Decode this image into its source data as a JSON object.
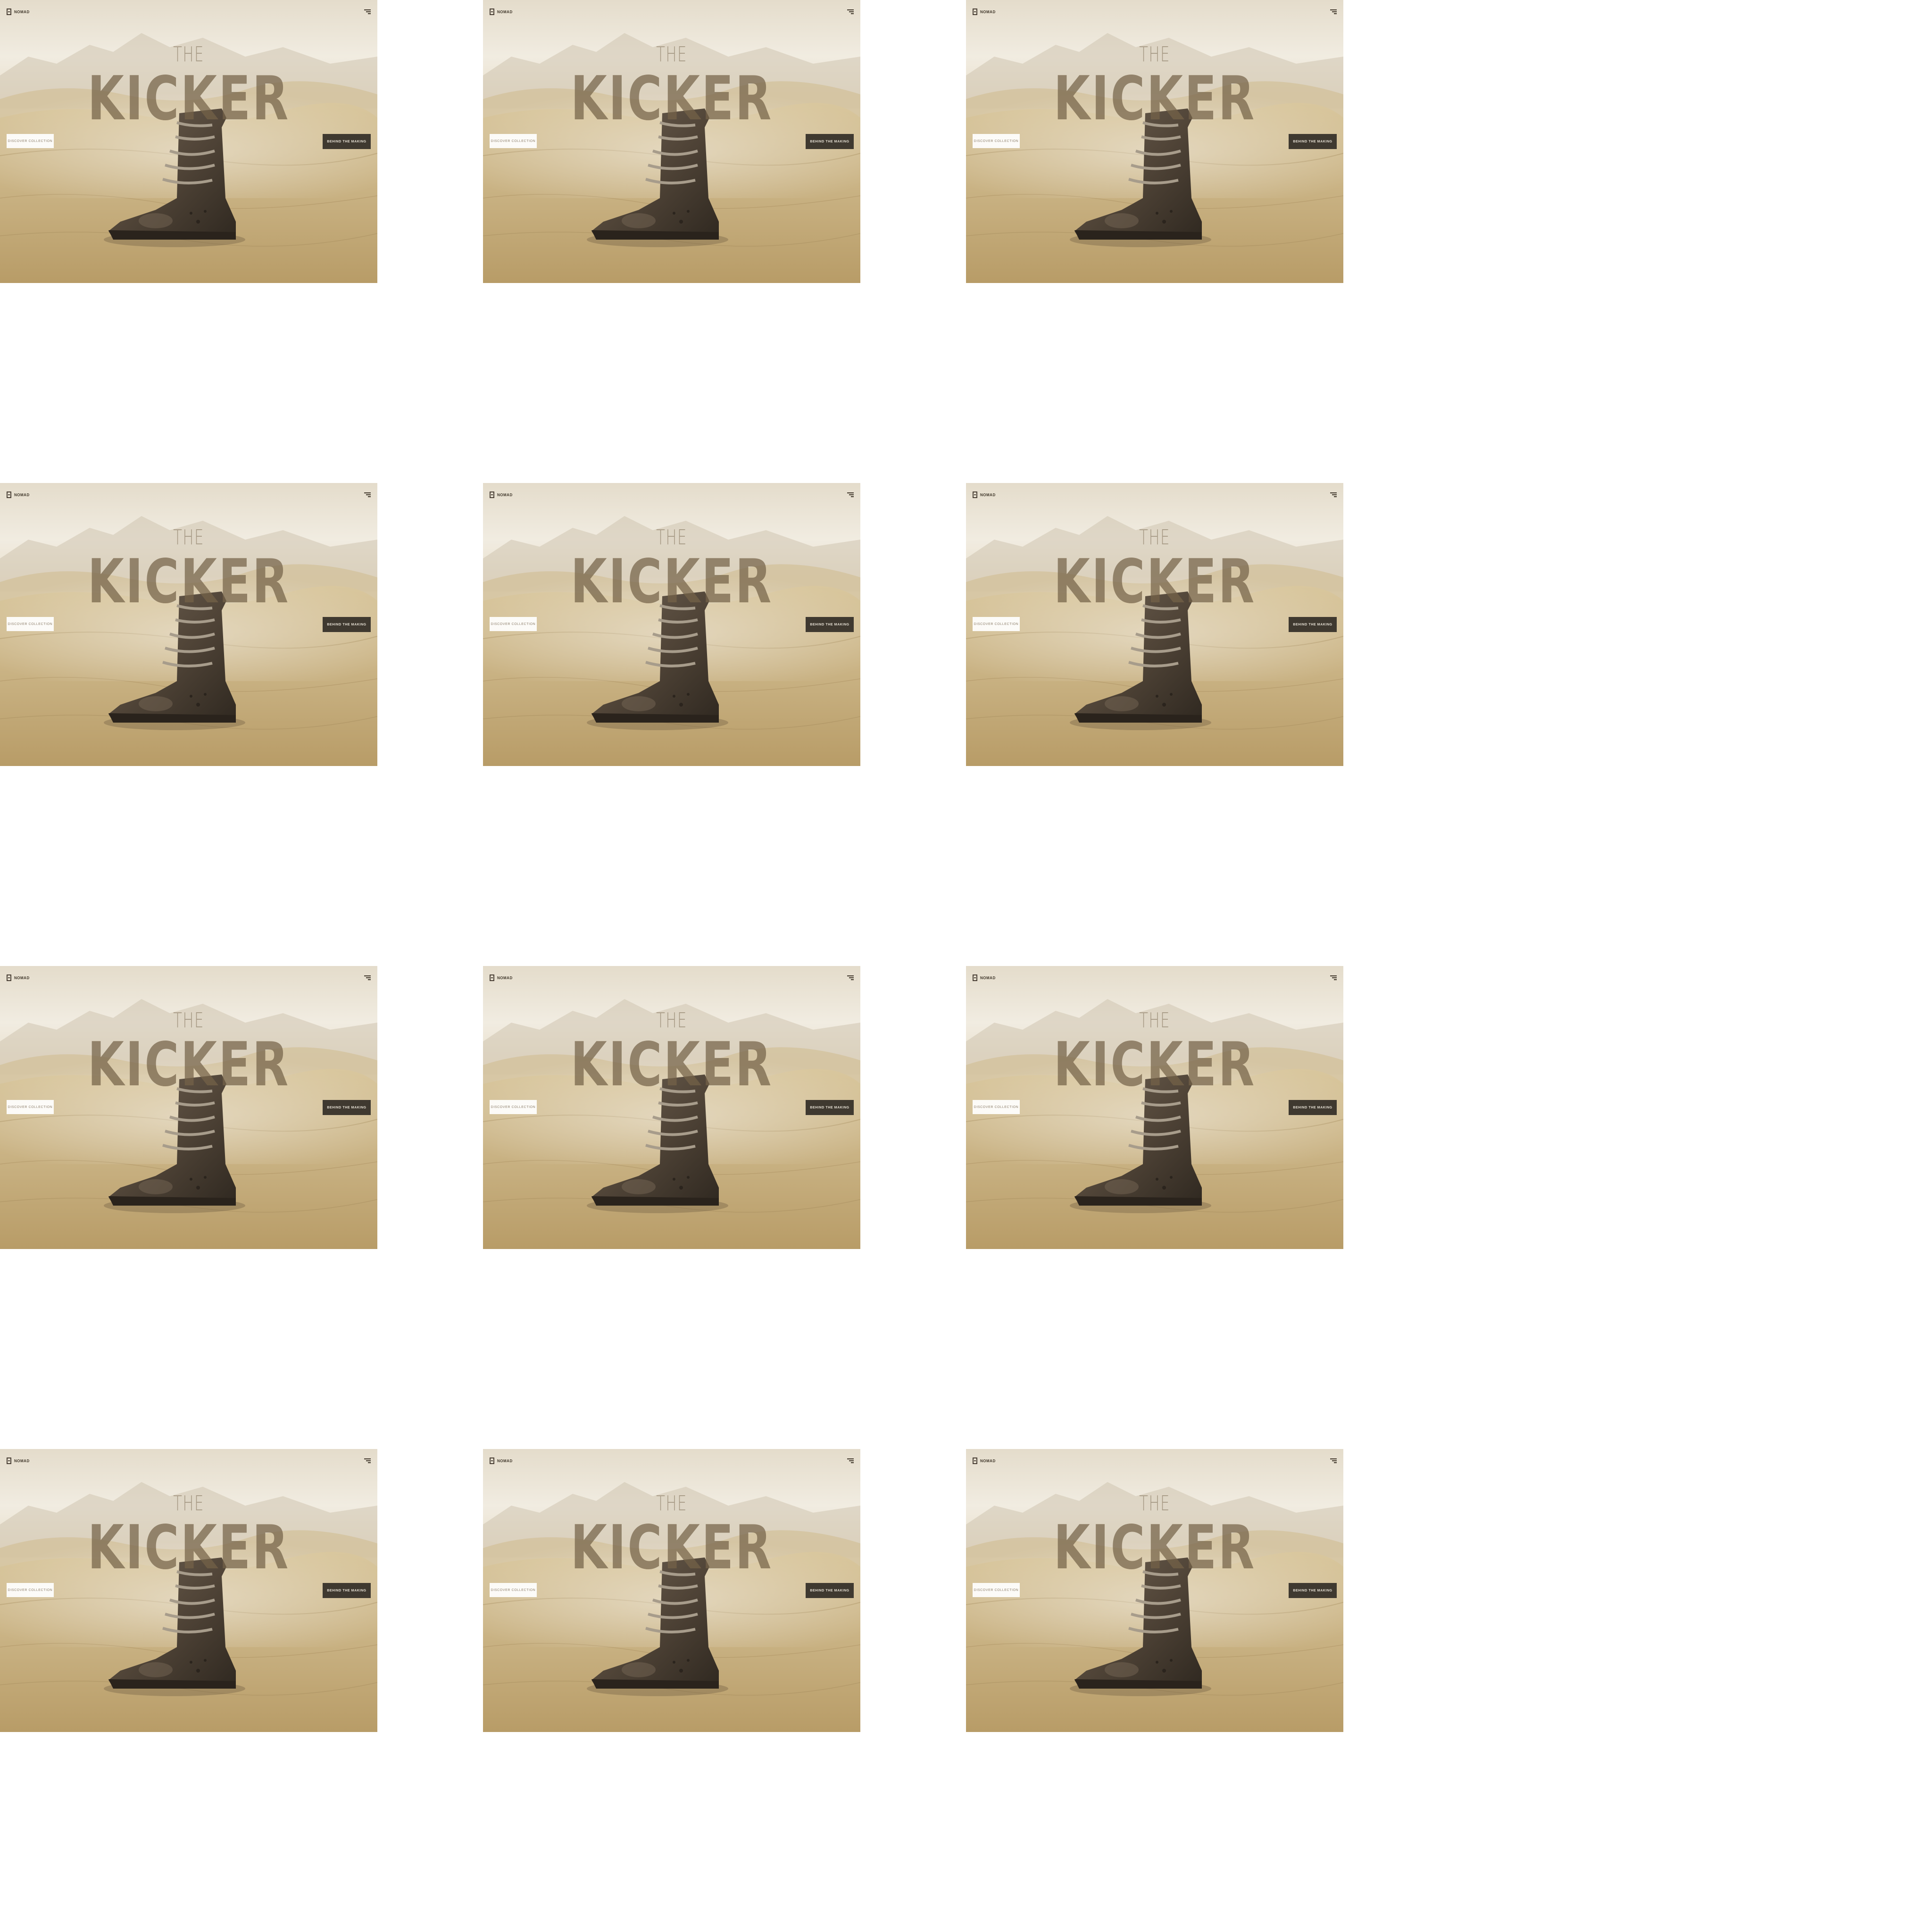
{
  "brand": {
    "name": "NOMAD"
  },
  "hero": {
    "small": "THE",
    "big": "KICKER"
  },
  "buttons": {
    "left_label": "DISCOVER COLLECTION",
    "right_label": "BEHIND THE MAKING"
  },
  "icons": {
    "menu": "menu-icon",
    "brand": "brand-logo-icon"
  },
  "colors": {
    "sand": "#d8cbaa",
    "sky": "#eee6d6",
    "dark_button": "#3f3930",
    "boot": "#5a4d40"
  }
}
